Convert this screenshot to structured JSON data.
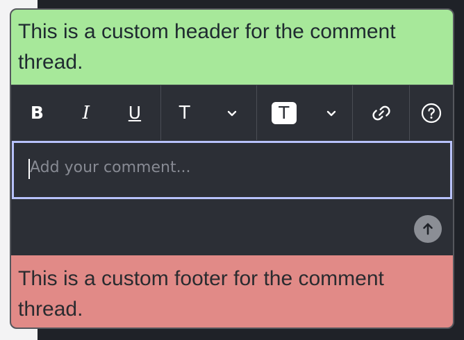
{
  "header": {
    "text": "This is a custom header for the comment thread."
  },
  "toolbar": {
    "bold_label": "B",
    "italic_label": "I",
    "underline_label": "U",
    "text_style_label": "T",
    "highlight_label": "T",
    "icons": {
      "text_style_dropdown": "chevron-down-icon",
      "highlight_dropdown": "chevron-down-icon",
      "link": "link-icon",
      "help": "help-icon"
    }
  },
  "editor": {
    "placeholder": "Add your comment..."
  },
  "send": {
    "icon": "arrow-up-icon"
  },
  "footer": {
    "text": "This is a custom footer for the comment thread."
  },
  "colors": {
    "header_background": "#a7e89a",
    "footer_background": "#e18a87",
    "editor_focus": "#b8c2ff",
    "toolbar_background": "#2c2f36"
  }
}
